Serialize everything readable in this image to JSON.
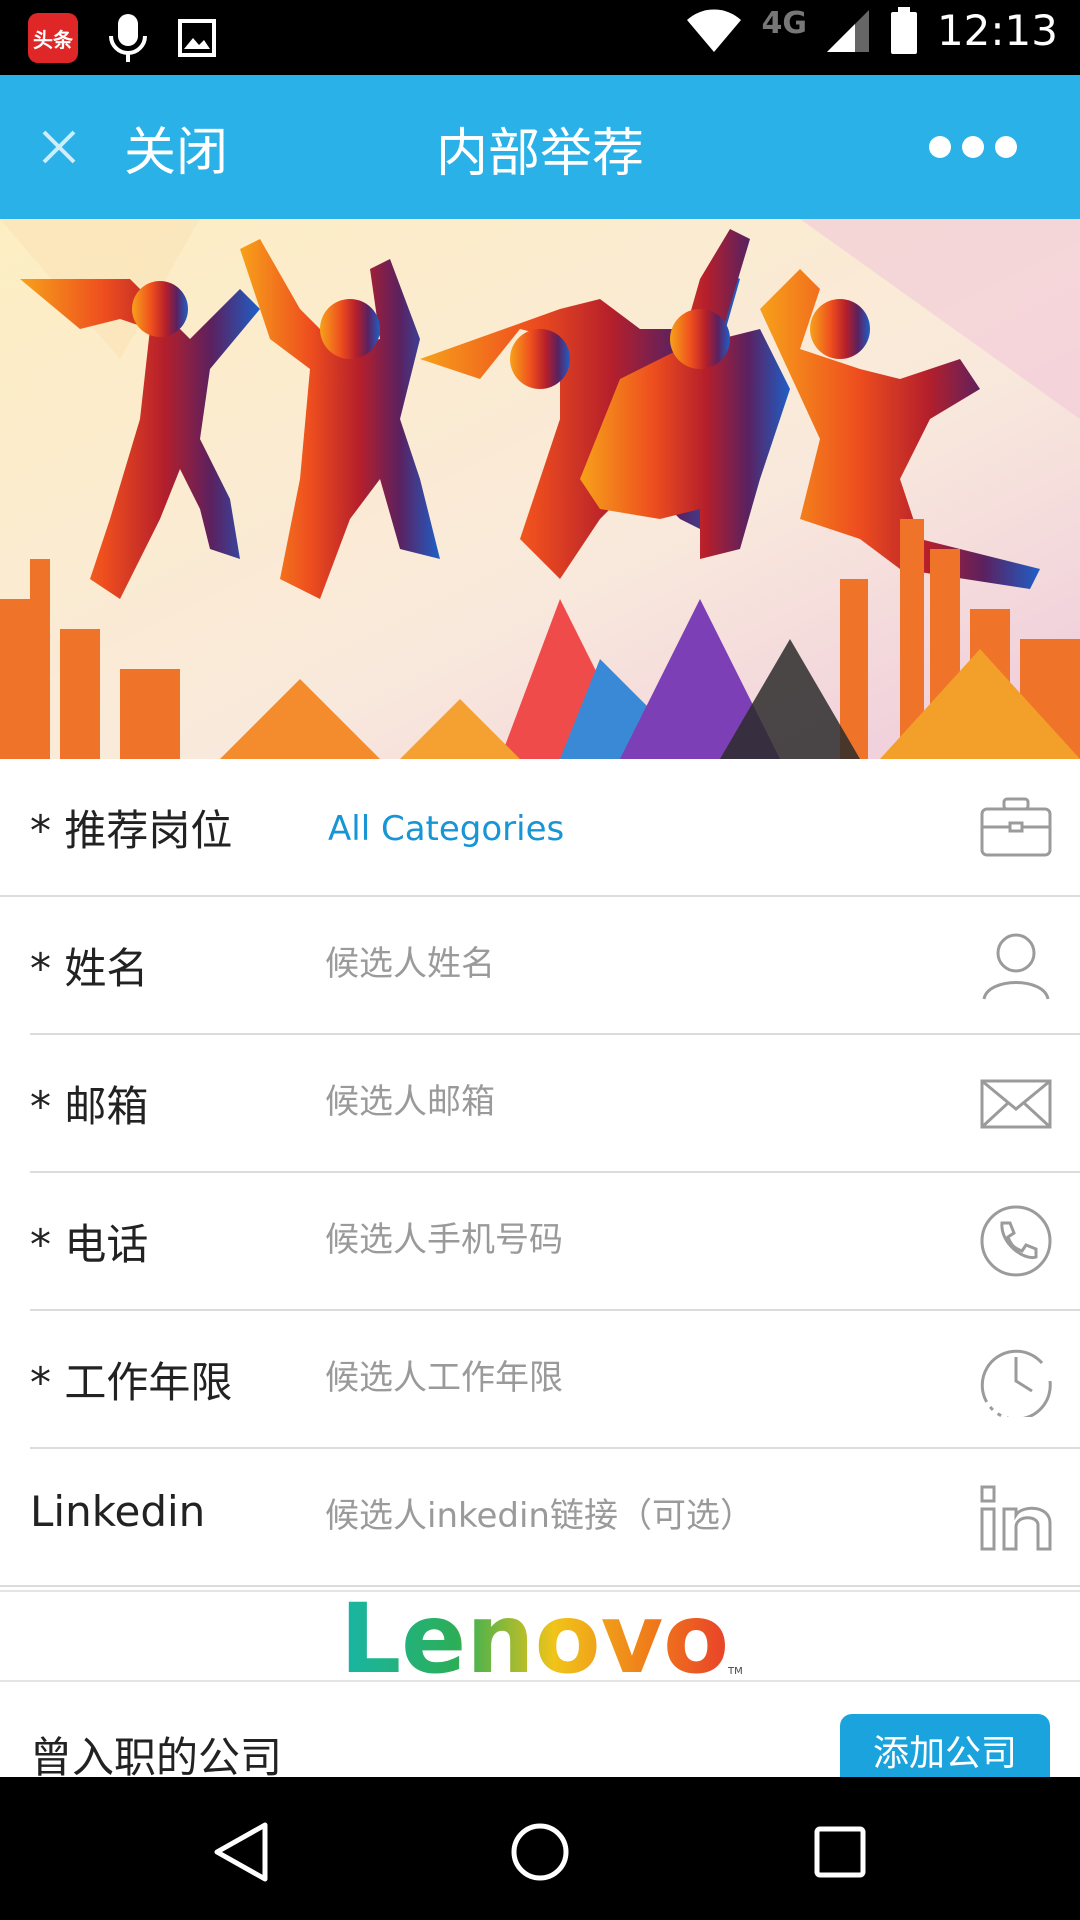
{
  "status_bar": {
    "app_icon_text": "头条",
    "network_label": "4G",
    "time": "12:13",
    "icons": [
      "toutiao-app-icon",
      "microphone-icon",
      "image-icon",
      "wifi-icon",
      "signal-icon",
      "battery-icon"
    ]
  },
  "header": {
    "close_label": "关闭",
    "title": "内部举荐",
    "more_icon": "more-dots-icon",
    "background_color": "#29b1e8"
  },
  "banner": {
    "description_icon": "jumping-people-banner-image"
  },
  "form": {
    "rows": [
      {
        "label": "* 推荐岗位",
        "value": "All Categories",
        "icon": "briefcase-icon"
      },
      {
        "label": "* 姓名",
        "placeholder": "候选人姓名",
        "value": "",
        "icon": "person-icon"
      },
      {
        "label": "* 邮箱",
        "placeholder": "候选人邮箱",
        "value": "",
        "icon": "envelope-icon"
      },
      {
        "label": "* 电话",
        "placeholder": "候选人手机号码",
        "value": "",
        "icon": "phone-icon"
      },
      {
        "label": "* 工作年限",
        "placeholder": "候选人工作年限",
        "value": "",
        "icon": "clock-icon"
      },
      {
        "label": "Linkedin",
        "placeholder": "候选人inkedin链接（可选）",
        "value": "",
        "icon": "linkedin-icon"
      }
    ]
  },
  "logo": {
    "text": "Lenovo",
    "tm": "TM"
  },
  "company": {
    "label": "曾入职的公司",
    "add_button": "添加公司"
  },
  "nav_bar": {
    "icons": [
      "back-triangle-icon",
      "home-circle-icon",
      "recents-square-icon"
    ]
  },
  "colors": {
    "accent": "#29b1e8",
    "link": "#1795d4",
    "button": "#1ba3dd"
  }
}
